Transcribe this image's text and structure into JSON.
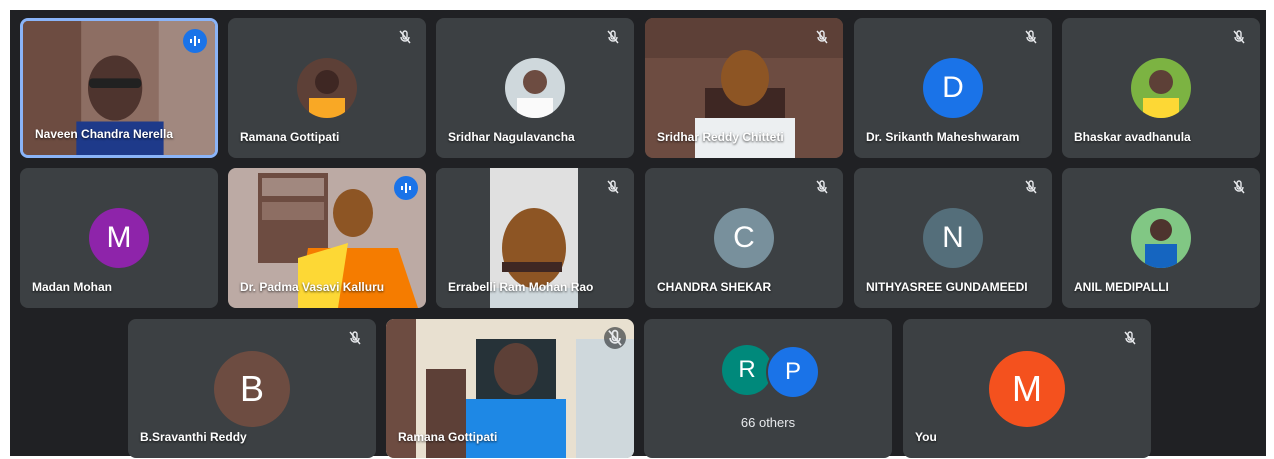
{
  "participants": [
    {
      "name": "Naveen Chandra Nerella",
      "speaking": true
    },
    {
      "name": "Ramana Gottipati",
      "muted": true
    },
    {
      "name": "Sridhar Nagulavancha",
      "muted": true
    },
    {
      "name": "Sridhar Reddy Chitteti",
      "muted": true
    },
    {
      "name": "Dr. Srikanth Maheshwaram",
      "initial": "D",
      "color": "#1a73e8",
      "muted": true
    },
    {
      "name": "Bhaskar avadhanula",
      "muted": true
    },
    {
      "name": "Madan Mohan",
      "initial": "M",
      "color": "#8e24aa"
    },
    {
      "name": "Dr. Padma Vasavi Kalluru",
      "speaking": true
    },
    {
      "name": "Errabelli Ram Mohan Rao",
      "muted": true
    },
    {
      "name": "CHANDRA SHEKAR",
      "initial": "C",
      "color": "#78909c",
      "muted": true
    },
    {
      "name": "NITHYASREE GUNDAMEEDI",
      "initial": "N",
      "color": "#546e7a",
      "muted": true
    },
    {
      "name": "ANIL MEDIPALLI",
      "muted": true
    },
    {
      "name": "B.Sravanthi Reddy",
      "initial": "B",
      "color": "#6d4c41",
      "muted": true
    },
    {
      "name": "Ramana Gottipati",
      "muted": true
    },
    {
      "name": "You",
      "initial": "M",
      "color": "#f4511e",
      "muted": true
    }
  ],
  "others": {
    "label": "66 others",
    "initials": [
      "R",
      "P"
    ],
    "colors": [
      "#00897b",
      "#1a73e8"
    ]
  },
  "icons": {
    "muted": "mic-off-icon",
    "speaking": "audio-level-icon"
  }
}
